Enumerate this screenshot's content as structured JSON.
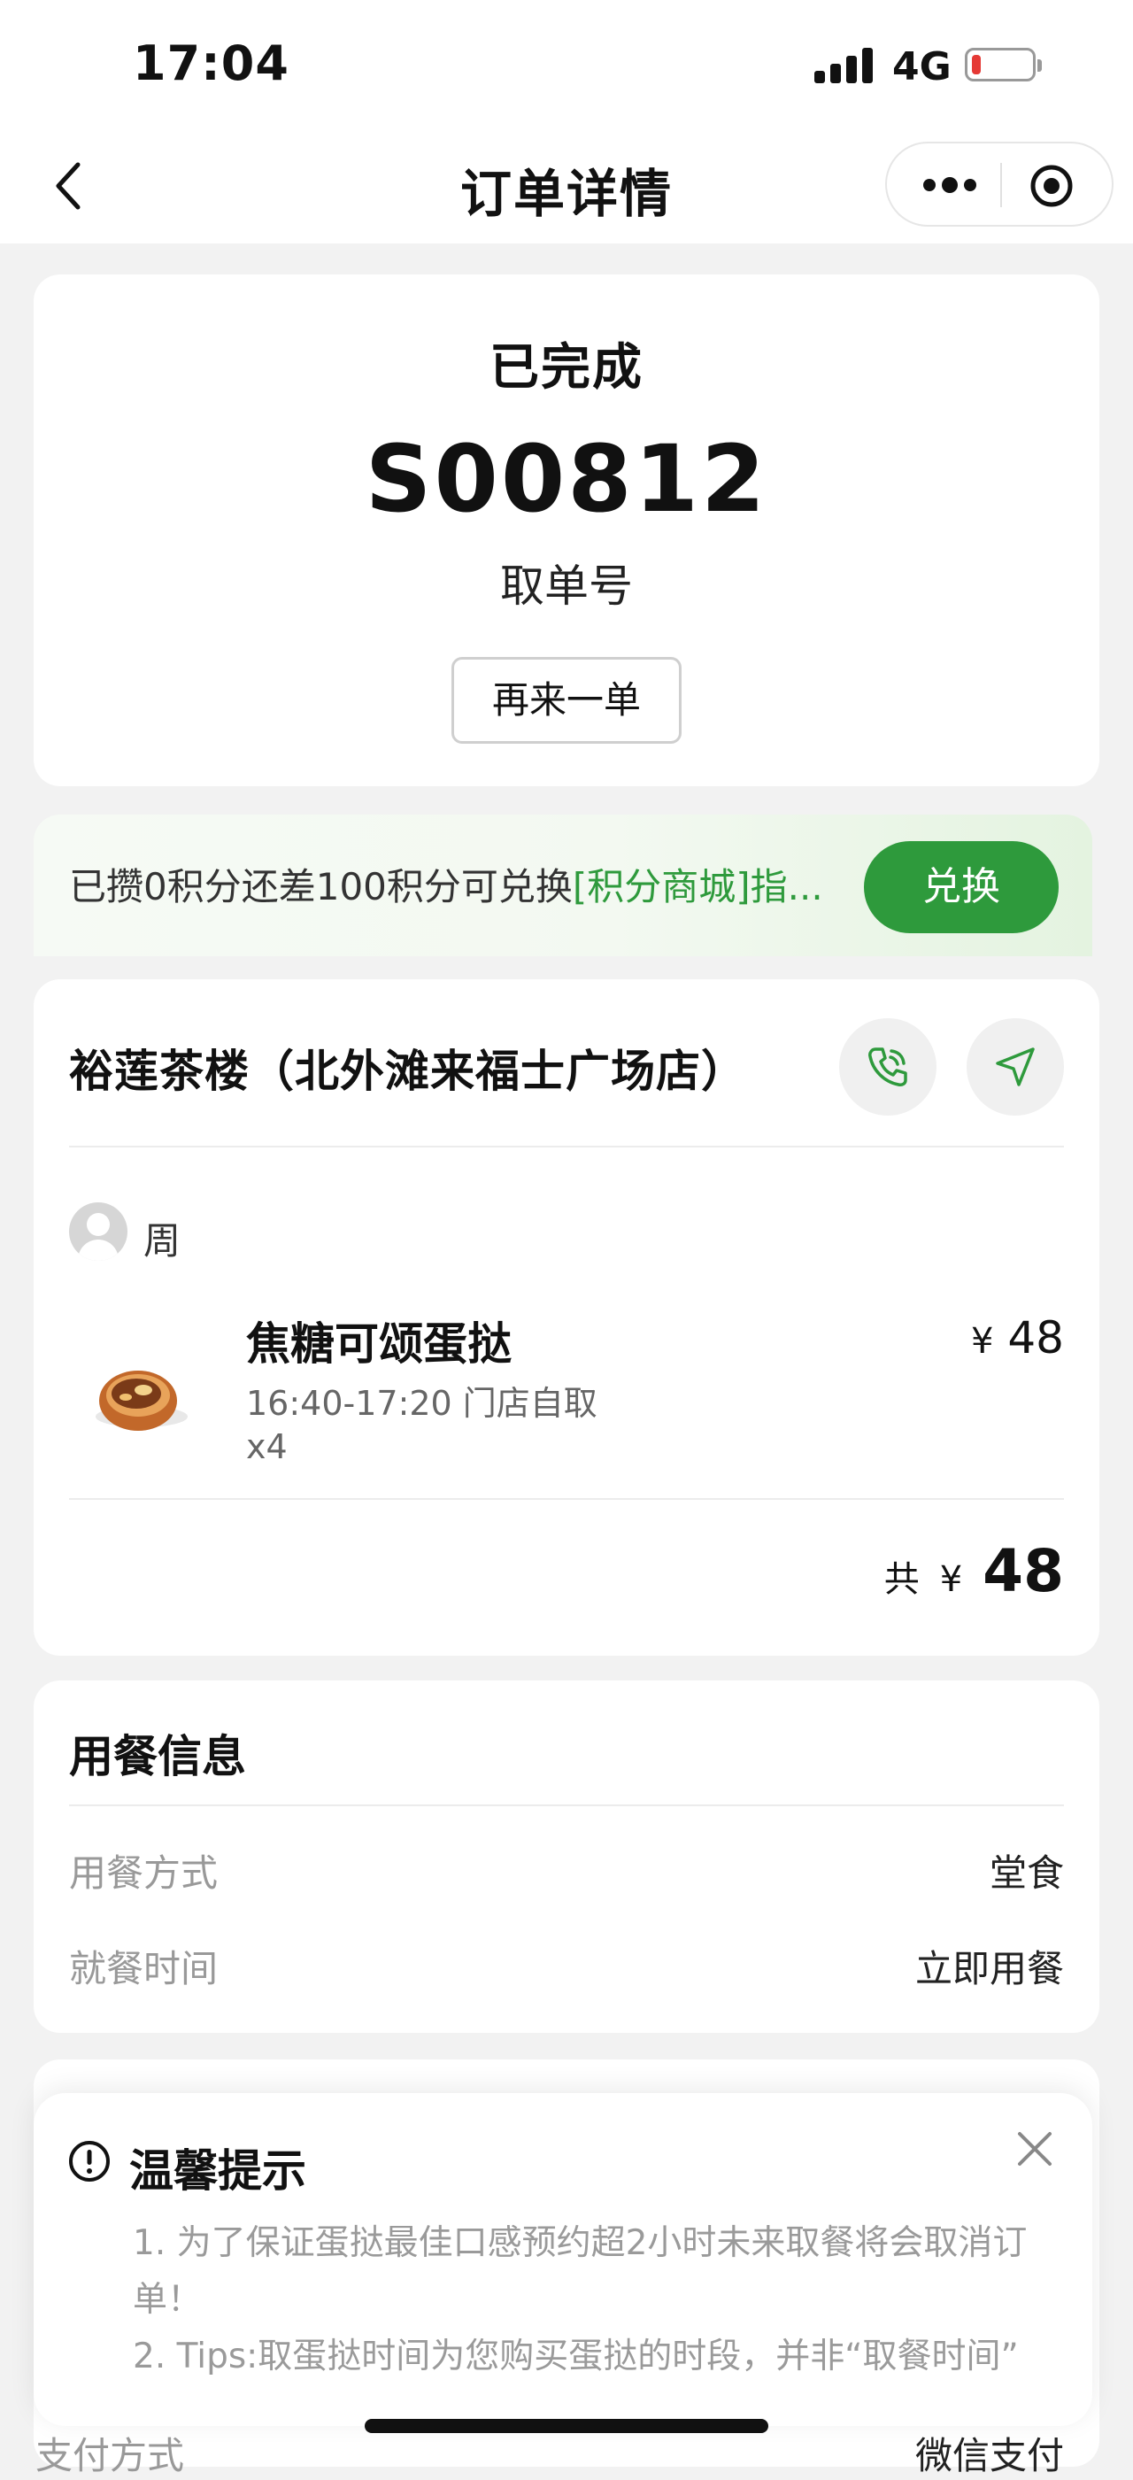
{
  "status_bar": {
    "time": "17:04",
    "network": "4G"
  },
  "nav": {
    "title": "订单详情"
  },
  "order": {
    "status": "已完成",
    "pickup_number": "S00812",
    "pickup_label": "取单号",
    "reorder_label": "再来一单"
  },
  "points": {
    "text_prefix": "已攒0积分还差100积分可兑换",
    "text_link": "[积分商城]指...",
    "exchange_label": "兑换"
  },
  "store": {
    "name": "裕莲茶楼（北外滩来福士广场店）",
    "user_name": "周",
    "item": {
      "name": "焦糖可颂蛋挞",
      "time_slot": "16:40-17:20 门店自取",
      "quantity": "x4",
      "currency": "¥",
      "price": "48"
    },
    "total_prefix": "共",
    "total_currency": "¥",
    "total": "48"
  },
  "dining": {
    "title": "用餐信息",
    "rows": [
      {
        "label": "用餐方式",
        "value": "堂食"
      },
      {
        "label": "就餐时间",
        "value": "立即用餐"
      }
    ]
  },
  "payment": {
    "label": "支付方式",
    "value": "微信支付"
  },
  "popup": {
    "title": "温馨提示",
    "tip1_line1": "1. 为了保证蛋挞最佳口感预约超2小时未来取餐将会取消订",
    "tip1_line2": "单！",
    "tip2": "2. Tips:取蛋挞时间为您购买蛋挞的时段，并非“取餐时间”"
  },
  "colors": {
    "accent_green": "#2e9a3c",
    "battery_low": "#e53935"
  }
}
